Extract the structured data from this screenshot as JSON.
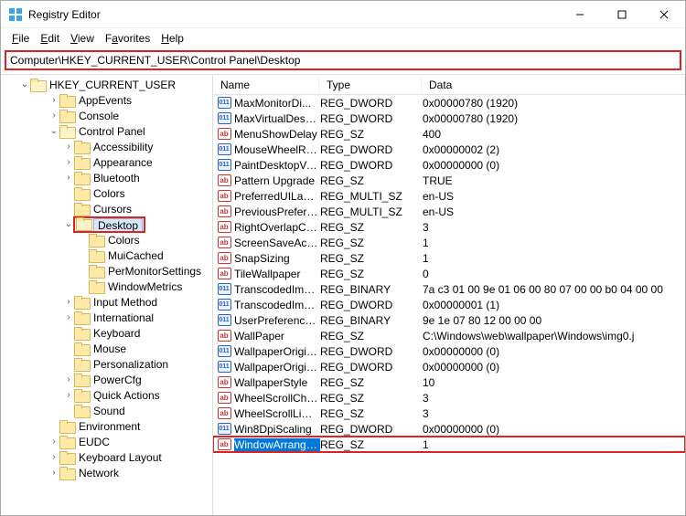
{
  "window": {
    "title": "Registry Editor"
  },
  "menu": {
    "file": "File",
    "edit": "Edit",
    "view": "View",
    "favorites": "Favorites",
    "help": "Help"
  },
  "address": "Computer\\HKEY_CURRENT_USER\\Control Panel\\Desktop",
  "tree": {
    "root": "HKEY_CURRENT_USER",
    "items": [
      {
        "label": "AppEvents",
        "depth": 2,
        "chev": ">"
      },
      {
        "label": "Console",
        "depth": 2,
        "chev": ">"
      },
      {
        "label": "Control Panel",
        "depth": 2,
        "chev": "v",
        "open": true
      },
      {
        "label": "Accessibility",
        "depth": 3,
        "chev": ">"
      },
      {
        "label": "Appearance",
        "depth": 3,
        "chev": ">"
      },
      {
        "label": "Bluetooth",
        "depth": 3,
        "chev": ">"
      },
      {
        "label": "Colors",
        "depth": 3,
        "chev": ""
      },
      {
        "label": "Cursors",
        "depth": 3,
        "chev": ""
      },
      {
        "label": "Desktop",
        "depth": 3,
        "chev": "v",
        "open": true,
        "selected": true,
        "highlight": true
      },
      {
        "label": "Colors",
        "depth": 4,
        "chev": ""
      },
      {
        "label": "MuiCached",
        "depth": 4,
        "chev": ""
      },
      {
        "label": "PerMonitorSettings",
        "depth": 4,
        "chev": ""
      },
      {
        "label": "WindowMetrics",
        "depth": 4,
        "chev": ""
      },
      {
        "label": "Input Method",
        "depth": 3,
        "chev": ">"
      },
      {
        "label": "International",
        "depth": 3,
        "chev": ">"
      },
      {
        "label": "Keyboard",
        "depth": 3,
        "chev": ""
      },
      {
        "label": "Mouse",
        "depth": 3,
        "chev": ""
      },
      {
        "label": "Personalization",
        "depth": 3,
        "chev": ""
      },
      {
        "label": "PowerCfg",
        "depth": 3,
        "chev": ">"
      },
      {
        "label": "Quick Actions",
        "depth": 3,
        "chev": ">"
      },
      {
        "label": "Sound",
        "depth": 3,
        "chev": ""
      },
      {
        "label": "Environment",
        "depth": 2,
        "chev": ""
      },
      {
        "label": "EUDC",
        "depth": 2,
        "chev": ">"
      },
      {
        "label": "Keyboard Layout",
        "depth": 2,
        "chev": ">"
      },
      {
        "label": "Network",
        "depth": 2,
        "chev": ">"
      }
    ]
  },
  "columns": {
    "name": "Name",
    "type": "Type",
    "data": "Data"
  },
  "values": [
    {
      "name": "MaxMonitorDi...",
      "type": "REG_DWORD",
      "data": "0x00000780 (1920)",
      "icon": "bin"
    },
    {
      "name": "MaxVirtualDeskt...",
      "type": "REG_DWORD",
      "data": "0x00000780 (1920)",
      "icon": "bin"
    },
    {
      "name": "MenuShowDelay",
      "type": "REG_SZ",
      "data": "400",
      "icon": "sz"
    },
    {
      "name": "MouseWheelRo...",
      "type": "REG_DWORD",
      "data": "0x00000002 (2)",
      "icon": "bin"
    },
    {
      "name": "PaintDesktopVer...",
      "type": "REG_DWORD",
      "data": "0x00000000 (0)",
      "icon": "bin"
    },
    {
      "name": "Pattern Upgrade",
      "type": "REG_SZ",
      "data": "TRUE",
      "icon": "sz"
    },
    {
      "name": "PreferredUILang...",
      "type": "REG_MULTI_SZ",
      "data": "en-US",
      "icon": "sz"
    },
    {
      "name": "PreviousPreferre...",
      "type": "REG_MULTI_SZ",
      "data": "en-US",
      "icon": "sz"
    },
    {
      "name": "RightOverlapCh...",
      "type": "REG_SZ",
      "data": "3",
      "icon": "sz"
    },
    {
      "name": "ScreenSaveActive",
      "type": "REG_SZ",
      "data": "1",
      "icon": "sz"
    },
    {
      "name": "SnapSizing",
      "type": "REG_SZ",
      "data": "1",
      "icon": "sz"
    },
    {
      "name": "TileWallpaper",
      "type": "REG_SZ",
      "data": "0",
      "icon": "sz"
    },
    {
      "name": "TranscodedImag...",
      "type": "REG_BINARY",
      "data": "7a c3 01 00 9e 01 06 00 80 07 00 00 b0 04 00 00",
      "icon": "bin"
    },
    {
      "name": "TranscodedImag...",
      "type": "REG_DWORD",
      "data": "0x00000001 (1)",
      "icon": "bin"
    },
    {
      "name": "UserPreferences...",
      "type": "REG_BINARY",
      "data": "9e 1e 07 80 12 00 00 00",
      "icon": "bin"
    },
    {
      "name": "WallPaper",
      "type": "REG_SZ",
      "data": "C:\\Windows\\web\\wallpaper\\Windows\\img0.j",
      "icon": "sz"
    },
    {
      "name": "WallpaperOriginX",
      "type": "REG_DWORD",
      "data": "0x00000000 (0)",
      "icon": "bin"
    },
    {
      "name": "WallpaperOriginY",
      "type": "REG_DWORD",
      "data": "0x00000000 (0)",
      "icon": "bin"
    },
    {
      "name": "WallpaperStyle",
      "type": "REG_SZ",
      "data": "10",
      "icon": "sz"
    },
    {
      "name": "WheelScrollChars",
      "type": "REG_SZ",
      "data": "3",
      "icon": "sz"
    },
    {
      "name": "WheelScrollLines",
      "type": "REG_SZ",
      "data": "3",
      "icon": "sz"
    },
    {
      "name": "Win8DpiScaling",
      "type": "REG_DWORD",
      "data": "0x00000000 (0)",
      "icon": "bin"
    },
    {
      "name": "WindowArrange...",
      "type": "REG_SZ",
      "data": "1",
      "icon": "sz",
      "selected": true,
      "highlight": true
    }
  ]
}
